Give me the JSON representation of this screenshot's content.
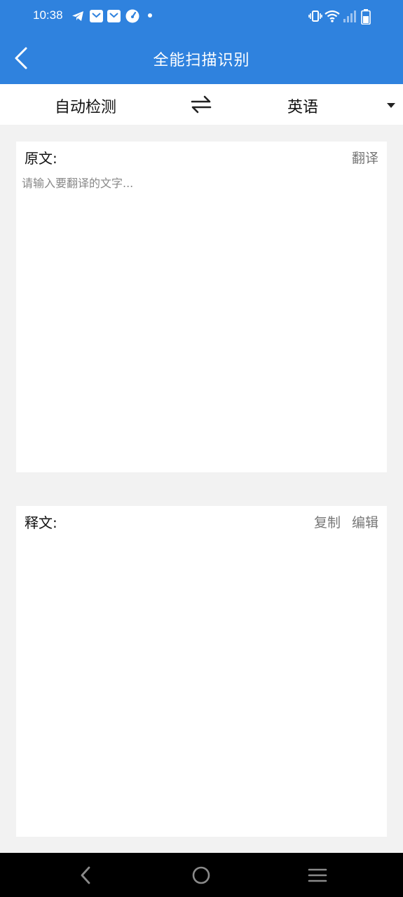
{
  "status_bar": {
    "time": "10:38",
    "left_icons": [
      "telegram-icon",
      "mail-icon",
      "mail-icon",
      "speedometer-icon",
      "dot-icon"
    ],
    "right_icons": [
      "vibrate-icon",
      "wifi-icon",
      "signal-icon",
      "battery-icon"
    ]
  },
  "header": {
    "title": "全能扫描识别"
  },
  "lang": {
    "source": "自动检测",
    "target": "英语"
  },
  "source_card": {
    "label": "原文:",
    "action": "翻译",
    "placeholder": "请输入要翻译的文字...",
    "value": ""
  },
  "result_card": {
    "label": "释文:",
    "copy": "复制",
    "edit": "编辑",
    "value": ""
  },
  "colors": {
    "header": "#2f82de",
    "background": "#f2f2f2",
    "navbar": "#000000"
  }
}
